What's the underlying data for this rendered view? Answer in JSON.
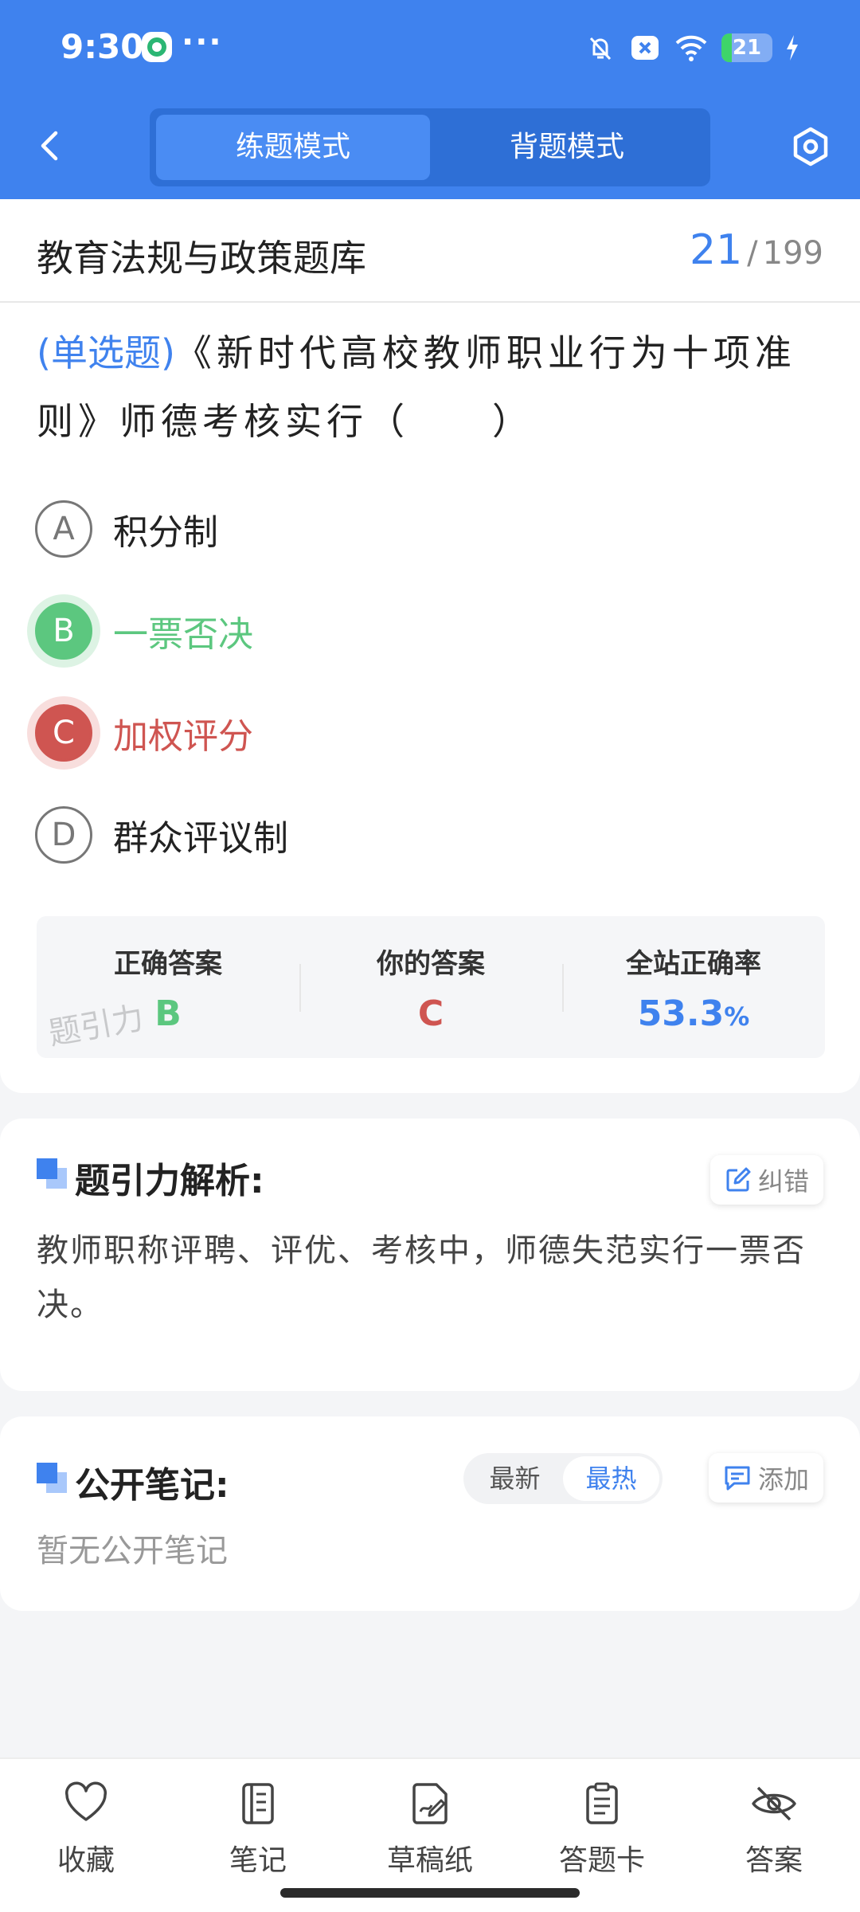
{
  "status_bar": {
    "time": "9:30",
    "dots": "···",
    "battery": "21",
    "battery_level_percent": 21
  },
  "header": {
    "modes": [
      {
        "label": "练题模式",
        "active": true
      },
      {
        "label": "背题模式",
        "active": false
      }
    ]
  },
  "bank": {
    "title": "教育法规与政策题库",
    "current": "21",
    "separator": "/",
    "total": "199"
  },
  "question": {
    "type": "(单选题)",
    "text": "《新时代高校教师职业行为十项准则》师德考核实行（　　）",
    "options": [
      {
        "letter": "A",
        "text": "积分制",
        "state": "normal"
      },
      {
        "letter": "B",
        "text": "一票否决",
        "state": "correct"
      },
      {
        "letter": "C",
        "text": "加权评分",
        "state": "wrong"
      },
      {
        "letter": "D",
        "text": "群众评议制",
        "state": "normal"
      }
    ]
  },
  "answer_summary": {
    "correct_label": "正确答案",
    "correct_value": "B",
    "yours_label": "你的答案",
    "yours_value": "C",
    "rate_label": "全站正确率",
    "rate_value": "53.3",
    "rate_unit": "%",
    "watermark": "题引力"
  },
  "analysis": {
    "title": "题引力解析:",
    "report_label": "纠错",
    "text": "教师职称评聘、评优、考核中，师德失范实行一票否决。"
  },
  "notes": {
    "title": "公开笔记:",
    "sort_newest": "最新",
    "sort_hottest": "最热",
    "add_label": "添加",
    "empty": "暂无公开笔记"
  },
  "bottom_nav": {
    "favorite": "收藏",
    "notes": "笔记",
    "scratch": "草稿纸",
    "answer_card": "答题卡",
    "answer": "答案"
  },
  "colors": {
    "primary": "#3f82ee",
    "correct": "#5cc77f",
    "wrong": "#cf5551"
  }
}
